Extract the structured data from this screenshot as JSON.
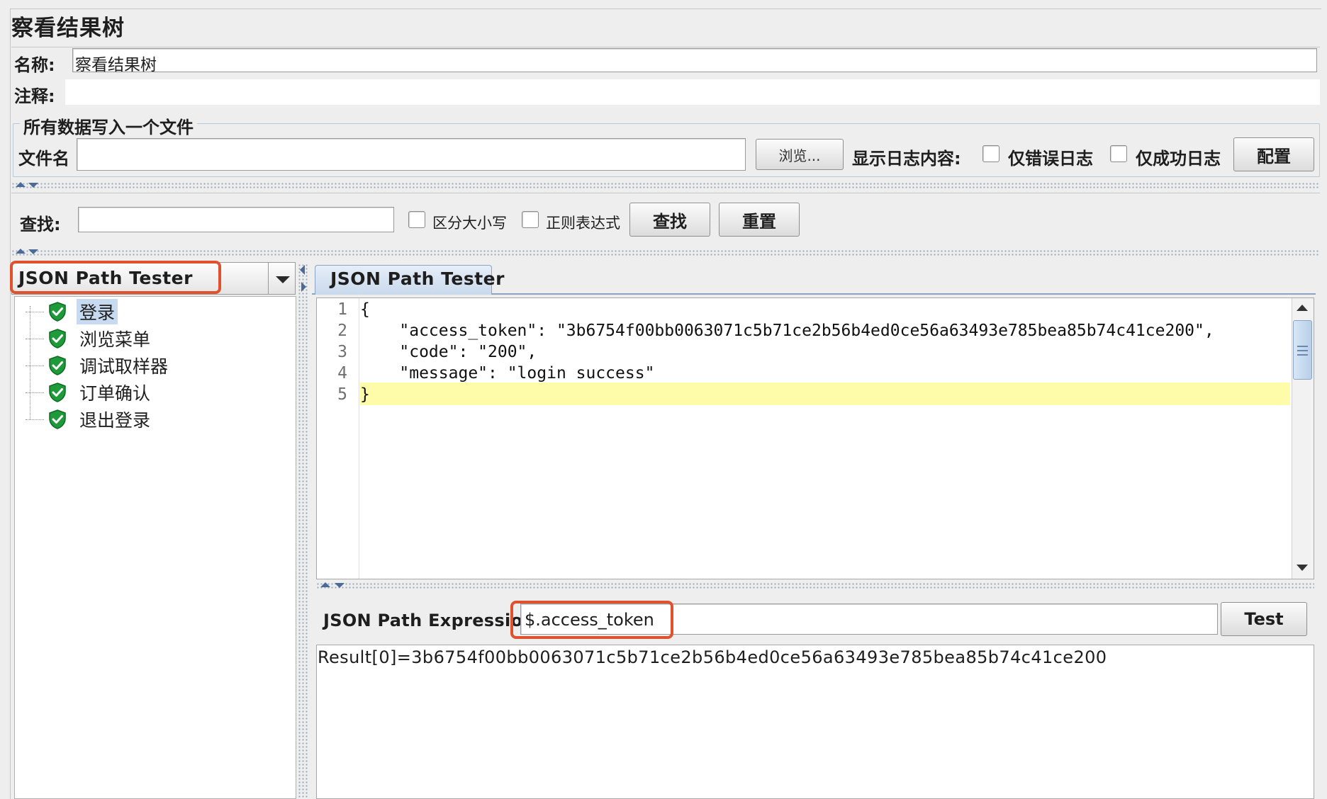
{
  "header": {
    "title": "察看结果树",
    "name_label": "名称:",
    "name_value": "察看结果树",
    "comment_label": "注释:"
  },
  "file_section": {
    "legend": "所有数据写入一个文件",
    "filename_label": "文件名",
    "filename_value": "",
    "browse_button": "浏览...",
    "log_label": "显示日志内容:",
    "errors_only_label": "仅错误日志",
    "success_only_label": "仅成功日志",
    "configure_button": "配置"
  },
  "search": {
    "label": "查找:",
    "value": "",
    "case_sensitive_label": "区分大小写",
    "regex_label": "正则表达式",
    "find_button": "查找",
    "reset_button": "重置"
  },
  "renderer": {
    "selected": "JSON Path Tester"
  },
  "tree": {
    "items": [
      {
        "label": "登录",
        "selected": true,
        "icon": "green-shield-check-icon"
      },
      {
        "label": "浏览菜单",
        "selected": false,
        "icon": "green-shield-check-icon"
      },
      {
        "label": "调试取样器",
        "selected": false,
        "icon": "green-shield-check-icon"
      },
      {
        "label": "订单确认",
        "selected": false,
        "icon": "green-shield-check-icon"
      },
      {
        "label": "退出登录",
        "selected": false,
        "icon": "green-shield-check-icon"
      }
    ]
  },
  "tester": {
    "tab_label": "JSON Path Tester",
    "line_numbers": [
      "1",
      "2",
      "3",
      "4",
      "5"
    ],
    "code_lines": [
      "{",
      "    \"access_token\": \"3b6754f00bb0063071c5b71ce2b56b4ed0ce56a63493e785bea85b74c41ce200\",",
      "    \"code\": \"200\",",
      "    \"message\": \"login success\"",
      "}"
    ],
    "expression_label": "JSON Path Expression",
    "expression_value": "$.access_token",
    "test_button": "Test",
    "result": "Result[0]=3b6754f00bb0063071c5b71ce2b56b4ed0ce56a63493e785bea85b74c41ce200"
  },
  "colors": {
    "highlight_annotation": "#e0522e",
    "current_line": "#fefca8",
    "tree_selection": "#c8daf0",
    "tab_background": "#c9d9ec"
  }
}
